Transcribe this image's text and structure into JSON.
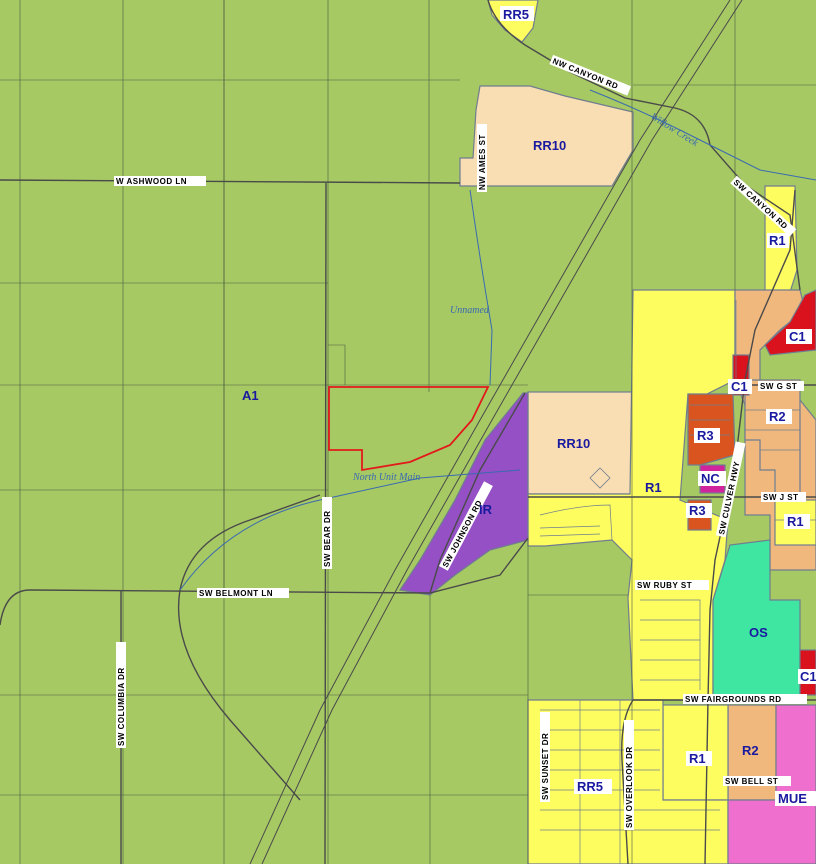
{
  "colors": {
    "a1": "#a6c964",
    "rr": "#f9deb3",
    "r1": "#fdfd5f",
    "r2": "#f1b87e",
    "r3": "#d9541e",
    "c1": "#d9121e",
    "nc": "#d1239d",
    "os": "#3ee6a2",
    "ir": "#9450c4",
    "mue": "#ef6fcf",
    "site": "#e31a1c"
  },
  "zones": {
    "rr5_top": "RR5",
    "rr10_north": "RR10",
    "r1_ne": "R1",
    "c1_ne": "C1",
    "c1_mid": "C1",
    "a1": "A1",
    "rr10_mid": "RR10",
    "r3_upper": "R3",
    "r2_upper": "R2",
    "nc": "NC",
    "r1_mid": "R1",
    "ir": "IR",
    "r3_lower": "R3",
    "r1_east": "R1",
    "os": "OS",
    "c1_east": "C1",
    "r2_lower": "R2",
    "r1_lower": "R1",
    "rr5_south": "RR5",
    "mue": "MUE"
  },
  "streets": {
    "nw_canyon_rd": "NW CANYON RD",
    "sw_canyon_rd": "SW CANYON RD",
    "w_ashwood_ln": "W ASHWOOD LN",
    "nw_ames_st": "NW AMES ST",
    "sw_g_st": "SW G ST",
    "sw_culver_hwy": "SW CULVER HWY",
    "sw_j_st": "SW J ST",
    "sw_johnson_rd": "SW JOHNSON RD",
    "sw_bear_dr": "SW BEAR DR",
    "sw_belmont_ln": "SW BELMONT LN",
    "sw_ruby_st": "SW RUBY ST",
    "sw_columbia_dr": "SW COLUMBIA DR",
    "sw_fairgrounds_rd": "SW FAIRGROUNDS RD",
    "sw_sunset_dr": "SW SUNSET DR",
    "sw_overlook_dr": "SW OVERLOOK DR",
    "sw_bell_st": "SW BELL ST"
  },
  "features": {
    "willow_creek": "Willow Creek",
    "unnamed": "Unnamed",
    "north_unit_main": "North Unit Main"
  }
}
